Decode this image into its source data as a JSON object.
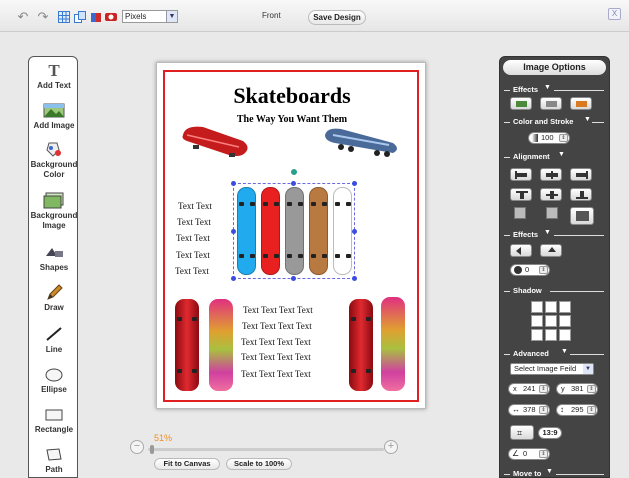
{
  "toolbar": {
    "unit": "Pixels",
    "side_label": "Front",
    "save_label": "Save Design",
    "close_label": "X"
  },
  "tools": [
    {
      "label": "Add Text",
      "icon": "text-tool-icon"
    },
    {
      "label": "Add Image",
      "icon": "image-tool-icon"
    },
    {
      "label": "Background Color",
      "icon": "bg-color-icon"
    },
    {
      "label": "Background Image",
      "icon": "bg-image-icon"
    },
    {
      "label": "Shapes",
      "icon": "shapes-icon"
    },
    {
      "label": "Draw",
      "icon": "pencil-icon"
    },
    {
      "label": "Line",
      "icon": "line-icon"
    },
    {
      "label": "Ellipse",
      "icon": "ellipse-icon"
    },
    {
      "label": "Rectangle",
      "icon": "rectangle-icon"
    },
    {
      "label": "Path",
      "icon": "path-icon"
    }
  ],
  "canvas": {
    "title": "Skateboards",
    "subtitle": "The Way You Want Them",
    "left_texts": [
      "Text Text",
      "Text Text",
      "Text Text",
      "Text Text",
      "Text Text"
    ],
    "bottom_texts": [
      "Text Text Text Text",
      "Text Text Text Text",
      "Text Text Text Text",
      "Text Text Text Text",
      "Text Text Text Text"
    ],
    "deck_colors": [
      "#22aaee",
      "#e82020",
      "#999999",
      "#b87a40",
      "#ffffff"
    ]
  },
  "zoom": {
    "percent_label": "51%",
    "level": 0.51,
    "fit_label": "Fit to Canvas",
    "scale_label": "Scale to 100%"
  },
  "options": {
    "title": "Image Options",
    "effects_label": "Effects",
    "color_stroke_label": "Color and Stroke",
    "opacity": "100",
    "alignment_label": "Alignment",
    "effects2_label": "Effects",
    "blur_value": "0",
    "shadow_label": "Shadow",
    "advanced_label": "Advanced",
    "select_field": "Select Image Feild",
    "x_label": "x",
    "x_value": "241",
    "y_label": "y",
    "y_value": "381",
    "width_value": "378",
    "height_value": "295",
    "ratio_label": "13:9",
    "angle_value": "0",
    "move_label": "Move to"
  }
}
